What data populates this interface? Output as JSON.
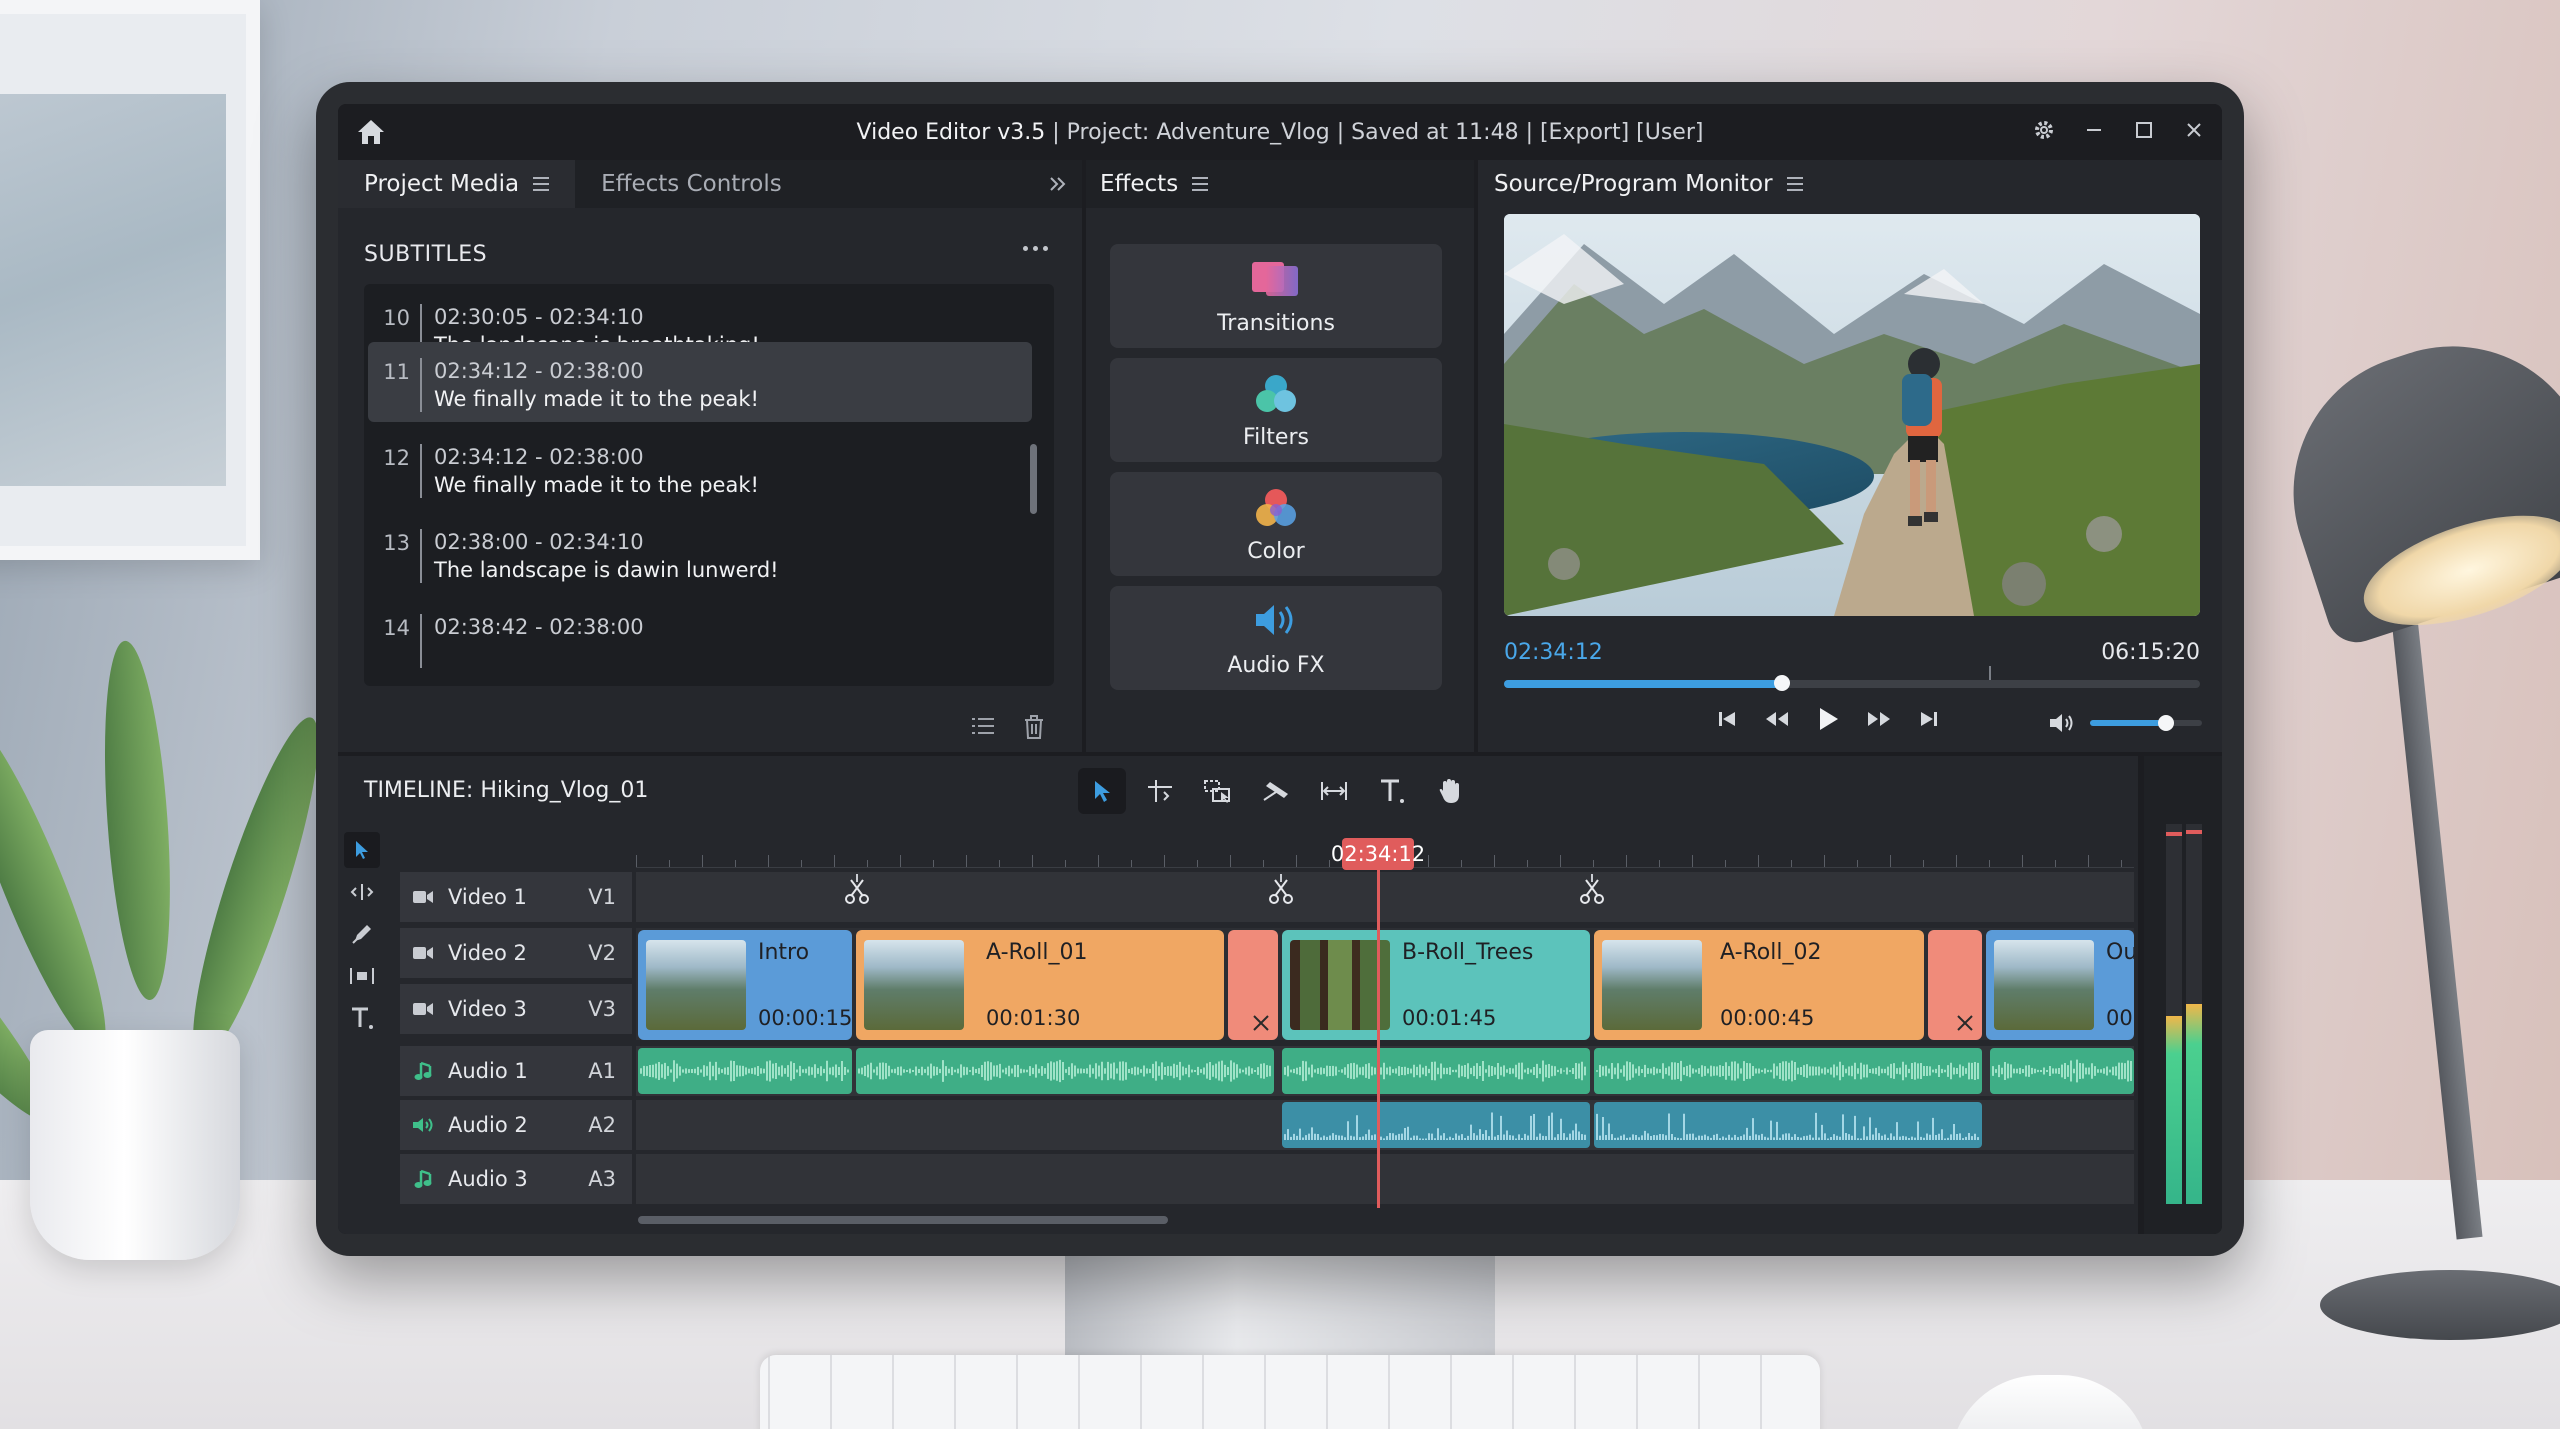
{
  "window": {
    "app_title": "Video Editor v3.5",
    "title_rest": " | Project: Adventure_Vlog | Saved at 11:48 | [Export] [User]"
  },
  "project_media": {
    "tabs": [
      {
        "label": "Project Media",
        "active": true
      },
      {
        "label": "Effects Controls",
        "active": false
      }
    ],
    "section_title": "SUBTITLES",
    "subtitles": [
      {
        "index": "10",
        "time": "02:30:05 - 02:34:10",
        "text": "The landscape is breathtaking!",
        "selected": false
      },
      {
        "index": "11",
        "time": "02:34:12 - 02:38:00",
        "text": "We finally made it to the peak!",
        "selected": true
      },
      {
        "index": "12",
        "time": "02:34:12 - 02:38:00",
        "text": "We finally made it to the peak!",
        "selected": false
      },
      {
        "index": "13",
        "time": "02:38:00 - 02:34:10",
        "text": "The landscape is dawin lunwerd!",
        "selected": false
      },
      {
        "index": "14",
        "time": "02:38:42 - 02:38:00",
        "text": "",
        "selected": false
      }
    ]
  },
  "effects": {
    "title": "Effects",
    "buttons": [
      {
        "label": "Transitions",
        "icon": "transitions-icon"
      },
      {
        "label": "Filters",
        "icon": "filters-icon"
      },
      {
        "label": "Color",
        "icon": "color-icon"
      },
      {
        "label": "Audio FX",
        "icon": "audio-fx-icon"
      }
    ]
  },
  "monitor": {
    "title": "Source/Program Monitor",
    "current_time": "02:34:12",
    "total_time": "06:15:20",
    "progress": 0.4,
    "volume": 0.68
  },
  "timeline": {
    "title": "TIMELINE: Hiking_Vlog_01",
    "playhead_time": "02:34:12",
    "tracks": [
      {
        "name": "Video 1",
        "code": "V1",
        "kind": "video"
      },
      {
        "name": "Video 2",
        "code": "V2",
        "kind": "video"
      },
      {
        "name": "Video 3",
        "code": "V3",
        "kind": "video"
      },
      {
        "name": "Audio 1",
        "code": "A1",
        "kind": "music"
      },
      {
        "name": "Audio 2",
        "code": "A2",
        "kind": "speaker"
      },
      {
        "name": "Audio 3",
        "code": "A3",
        "kind": "music"
      }
    ],
    "clips": [
      {
        "name": "Intro",
        "duration": "00:00:15",
        "color": "#5b9bd8"
      },
      {
        "name": "A-Roll_01",
        "duration": "00:01:30",
        "color": "#f0a763"
      },
      {
        "name": "B-Roll_Trees",
        "duration": "00:01:45",
        "color": "#5cc3bb"
      },
      {
        "name": "A-Roll_02",
        "duration": "00:00:45",
        "color": "#f0a763"
      },
      {
        "name": "Ou",
        "duration": "00",
        "color": "#5b9bd8"
      }
    ]
  },
  "colors": {
    "accent": "#3d9de0",
    "playhead": "#e05c5c",
    "audio1": "#3fae86",
    "audio2": "#3c8fa6",
    "transition": "#f08b7a"
  }
}
